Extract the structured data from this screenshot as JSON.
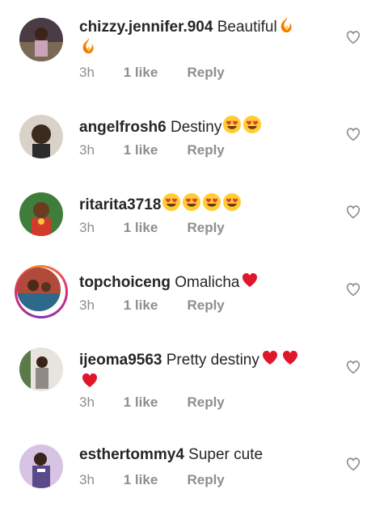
{
  "comments": [
    {
      "username": "chizzy.jennifer.904",
      "text": "Beautiful",
      "emojis": [
        "fire",
        "fire"
      ],
      "time": "3h",
      "likes": "1 like",
      "reply": "Reply"
    },
    {
      "username": "angelfrosh6",
      "text": "Destiny",
      "emojis": [
        "heart-eyes",
        "heart-eyes"
      ],
      "time": "3h",
      "likes": "1 like",
      "reply": "Reply"
    },
    {
      "username": "ritarita3718",
      "text": "",
      "emojis": [
        "heart-eyes",
        "heart-eyes",
        "heart-eyes",
        "heart-eyes"
      ],
      "time": "3h",
      "likes": "1 like",
      "reply": "Reply"
    },
    {
      "username": "topchoiceng",
      "text": "Omalicha",
      "emojis": [
        "red-heart"
      ],
      "time": "3h",
      "likes": "1 like",
      "reply": "Reply"
    },
    {
      "username": "ijeoma9563",
      "text": "Pretty destiny",
      "emojis": [
        "red-heart",
        "red-heart",
        "red-heart"
      ],
      "time": "3h",
      "likes": "1 like",
      "reply": "Reply"
    },
    {
      "username": "esthertommy4",
      "text": "Super cute",
      "emojis": [],
      "time": "3h",
      "likes": "1 like",
      "reply": "Reply"
    }
  ],
  "colors": {
    "text": "#262626",
    "meta": "#8e8e8e",
    "like_outline": "#8e8e8e"
  },
  "icons": {
    "like": "heart-outline-icon"
  }
}
